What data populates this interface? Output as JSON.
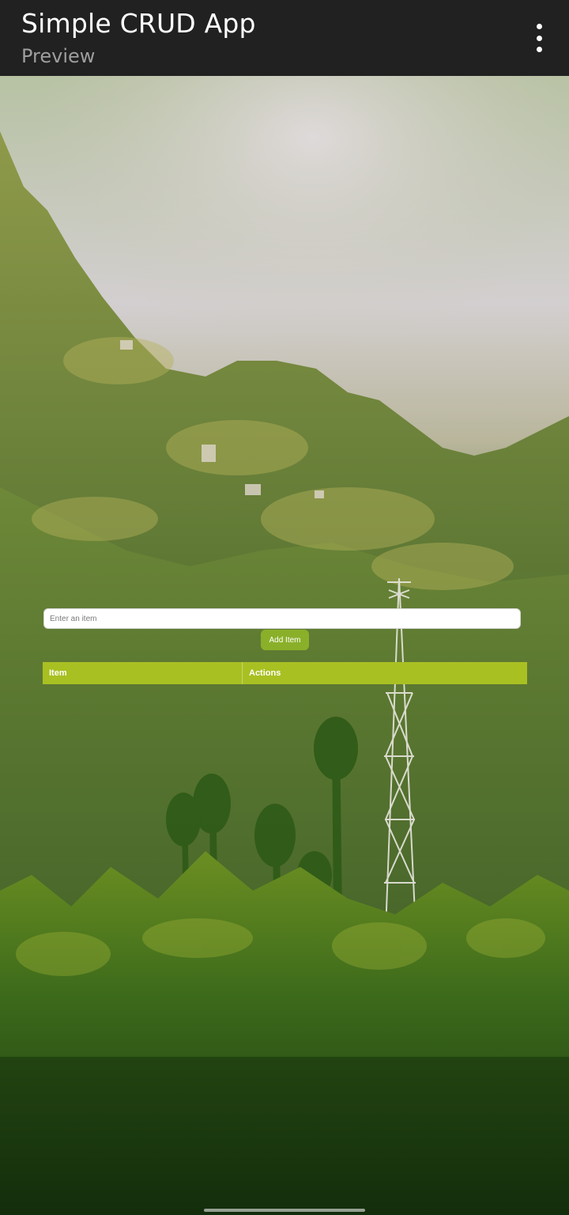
{
  "app_bar": {
    "title": "Simple CRUD App",
    "subtitle": "Preview",
    "menu_icon": "more-vert-icon"
  },
  "form": {
    "input_placeholder": "Enter an item",
    "input_value": "",
    "add_button_label": "Add Item"
  },
  "table": {
    "headers": [
      "Item",
      "Actions"
    ],
    "rows": []
  },
  "colors": {
    "app_bar_bg": "#212121",
    "accent_button": "#8ab02a",
    "table_header_bg": "#a9c022"
  }
}
